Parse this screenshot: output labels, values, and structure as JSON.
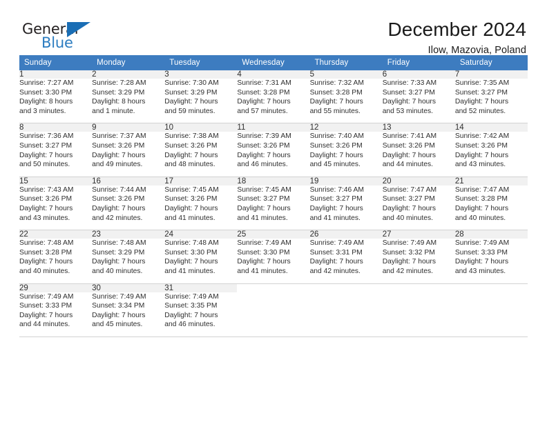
{
  "brand": {
    "name_top": "General",
    "name_bottom": "Blue",
    "accent_color": "#2b7cc0",
    "triangle_color": "#1a6eb5"
  },
  "header": {
    "title": "December 2024",
    "subtitle": "Ilow, Mazovia, Poland"
  },
  "calendar": {
    "header_bg": "#3d7cc0",
    "header_text_color": "#ffffff",
    "daynum_bg": "#f1f1f1",
    "weekday_headers": [
      "Sunday",
      "Monday",
      "Tuesday",
      "Wednesday",
      "Thursday",
      "Friday",
      "Saturday"
    ],
    "weeks": [
      [
        {
          "day": "1",
          "sunrise": "Sunrise: 7:27 AM",
          "sunset": "Sunset: 3:30 PM",
          "daylight_line1": "Daylight: 8 hours",
          "daylight_line2": "and 3 minutes."
        },
        {
          "day": "2",
          "sunrise": "Sunrise: 7:28 AM",
          "sunset": "Sunset: 3:29 PM",
          "daylight_line1": "Daylight: 8 hours",
          "daylight_line2": "and 1 minute."
        },
        {
          "day": "3",
          "sunrise": "Sunrise: 7:30 AM",
          "sunset": "Sunset: 3:29 PM",
          "daylight_line1": "Daylight: 7 hours",
          "daylight_line2": "and 59 minutes."
        },
        {
          "day": "4",
          "sunrise": "Sunrise: 7:31 AM",
          "sunset": "Sunset: 3:28 PM",
          "daylight_line1": "Daylight: 7 hours",
          "daylight_line2": "and 57 minutes."
        },
        {
          "day": "5",
          "sunrise": "Sunrise: 7:32 AM",
          "sunset": "Sunset: 3:28 PM",
          "daylight_line1": "Daylight: 7 hours",
          "daylight_line2": "and 55 minutes."
        },
        {
          "day": "6",
          "sunrise": "Sunrise: 7:33 AM",
          "sunset": "Sunset: 3:27 PM",
          "daylight_line1": "Daylight: 7 hours",
          "daylight_line2": "and 53 minutes."
        },
        {
          "day": "7",
          "sunrise": "Sunrise: 7:35 AM",
          "sunset": "Sunset: 3:27 PM",
          "daylight_line1": "Daylight: 7 hours",
          "daylight_line2": "and 52 minutes."
        }
      ],
      [
        {
          "day": "8",
          "sunrise": "Sunrise: 7:36 AM",
          "sunset": "Sunset: 3:27 PM",
          "daylight_line1": "Daylight: 7 hours",
          "daylight_line2": "and 50 minutes."
        },
        {
          "day": "9",
          "sunrise": "Sunrise: 7:37 AM",
          "sunset": "Sunset: 3:26 PM",
          "daylight_line1": "Daylight: 7 hours",
          "daylight_line2": "and 49 minutes."
        },
        {
          "day": "10",
          "sunrise": "Sunrise: 7:38 AM",
          "sunset": "Sunset: 3:26 PM",
          "daylight_line1": "Daylight: 7 hours",
          "daylight_line2": "and 48 minutes."
        },
        {
          "day": "11",
          "sunrise": "Sunrise: 7:39 AM",
          "sunset": "Sunset: 3:26 PM",
          "daylight_line1": "Daylight: 7 hours",
          "daylight_line2": "and 46 minutes."
        },
        {
          "day": "12",
          "sunrise": "Sunrise: 7:40 AM",
          "sunset": "Sunset: 3:26 PM",
          "daylight_line1": "Daylight: 7 hours",
          "daylight_line2": "and 45 minutes."
        },
        {
          "day": "13",
          "sunrise": "Sunrise: 7:41 AM",
          "sunset": "Sunset: 3:26 PM",
          "daylight_line1": "Daylight: 7 hours",
          "daylight_line2": "and 44 minutes."
        },
        {
          "day": "14",
          "sunrise": "Sunrise: 7:42 AM",
          "sunset": "Sunset: 3:26 PM",
          "daylight_line1": "Daylight: 7 hours",
          "daylight_line2": "and 43 minutes."
        }
      ],
      [
        {
          "day": "15",
          "sunrise": "Sunrise: 7:43 AM",
          "sunset": "Sunset: 3:26 PM",
          "daylight_line1": "Daylight: 7 hours",
          "daylight_line2": "and 43 minutes."
        },
        {
          "day": "16",
          "sunrise": "Sunrise: 7:44 AM",
          "sunset": "Sunset: 3:26 PM",
          "daylight_line1": "Daylight: 7 hours",
          "daylight_line2": "and 42 minutes."
        },
        {
          "day": "17",
          "sunrise": "Sunrise: 7:45 AM",
          "sunset": "Sunset: 3:26 PM",
          "daylight_line1": "Daylight: 7 hours",
          "daylight_line2": "and 41 minutes."
        },
        {
          "day": "18",
          "sunrise": "Sunrise: 7:45 AM",
          "sunset": "Sunset: 3:27 PM",
          "daylight_line1": "Daylight: 7 hours",
          "daylight_line2": "and 41 minutes."
        },
        {
          "day": "19",
          "sunrise": "Sunrise: 7:46 AM",
          "sunset": "Sunset: 3:27 PM",
          "daylight_line1": "Daylight: 7 hours",
          "daylight_line2": "and 41 minutes."
        },
        {
          "day": "20",
          "sunrise": "Sunrise: 7:47 AM",
          "sunset": "Sunset: 3:27 PM",
          "daylight_line1": "Daylight: 7 hours",
          "daylight_line2": "and 40 minutes."
        },
        {
          "day": "21",
          "sunrise": "Sunrise: 7:47 AM",
          "sunset": "Sunset: 3:28 PM",
          "daylight_line1": "Daylight: 7 hours",
          "daylight_line2": "and 40 minutes."
        }
      ],
      [
        {
          "day": "22",
          "sunrise": "Sunrise: 7:48 AM",
          "sunset": "Sunset: 3:28 PM",
          "daylight_line1": "Daylight: 7 hours",
          "daylight_line2": "and 40 minutes."
        },
        {
          "day": "23",
          "sunrise": "Sunrise: 7:48 AM",
          "sunset": "Sunset: 3:29 PM",
          "daylight_line1": "Daylight: 7 hours",
          "daylight_line2": "and 40 minutes."
        },
        {
          "day": "24",
          "sunrise": "Sunrise: 7:48 AM",
          "sunset": "Sunset: 3:30 PM",
          "daylight_line1": "Daylight: 7 hours",
          "daylight_line2": "and 41 minutes."
        },
        {
          "day": "25",
          "sunrise": "Sunrise: 7:49 AM",
          "sunset": "Sunset: 3:30 PM",
          "daylight_line1": "Daylight: 7 hours",
          "daylight_line2": "and 41 minutes."
        },
        {
          "day": "26",
          "sunrise": "Sunrise: 7:49 AM",
          "sunset": "Sunset: 3:31 PM",
          "daylight_line1": "Daylight: 7 hours",
          "daylight_line2": "and 42 minutes."
        },
        {
          "day": "27",
          "sunrise": "Sunrise: 7:49 AM",
          "sunset": "Sunset: 3:32 PM",
          "daylight_line1": "Daylight: 7 hours",
          "daylight_line2": "and 42 minutes."
        },
        {
          "day": "28",
          "sunrise": "Sunrise: 7:49 AM",
          "sunset": "Sunset: 3:33 PM",
          "daylight_line1": "Daylight: 7 hours",
          "daylight_line2": "and 43 minutes."
        }
      ],
      [
        {
          "day": "29",
          "sunrise": "Sunrise: 7:49 AM",
          "sunset": "Sunset: 3:33 PM",
          "daylight_line1": "Daylight: 7 hours",
          "daylight_line2": "and 44 minutes."
        },
        {
          "day": "30",
          "sunrise": "Sunrise: 7:49 AM",
          "sunset": "Sunset: 3:34 PM",
          "daylight_line1": "Daylight: 7 hours",
          "daylight_line2": "and 45 minutes."
        },
        {
          "day": "31",
          "sunrise": "Sunrise: 7:49 AM",
          "sunset": "Sunset: 3:35 PM",
          "daylight_line1": "Daylight: 7 hours",
          "daylight_line2": "and 46 minutes."
        },
        {
          "day": "",
          "sunrise": "",
          "sunset": "",
          "daylight_line1": "",
          "daylight_line2": ""
        },
        {
          "day": "",
          "sunrise": "",
          "sunset": "",
          "daylight_line1": "",
          "daylight_line2": ""
        },
        {
          "day": "",
          "sunrise": "",
          "sunset": "",
          "daylight_line1": "",
          "daylight_line2": ""
        },
        {
          "day": "",
          "sunrise": "",
          "sunset": "",
          "daylight_line1": "",
          "daylight_line2": ""
        }
      ]
    ]
  }
}
